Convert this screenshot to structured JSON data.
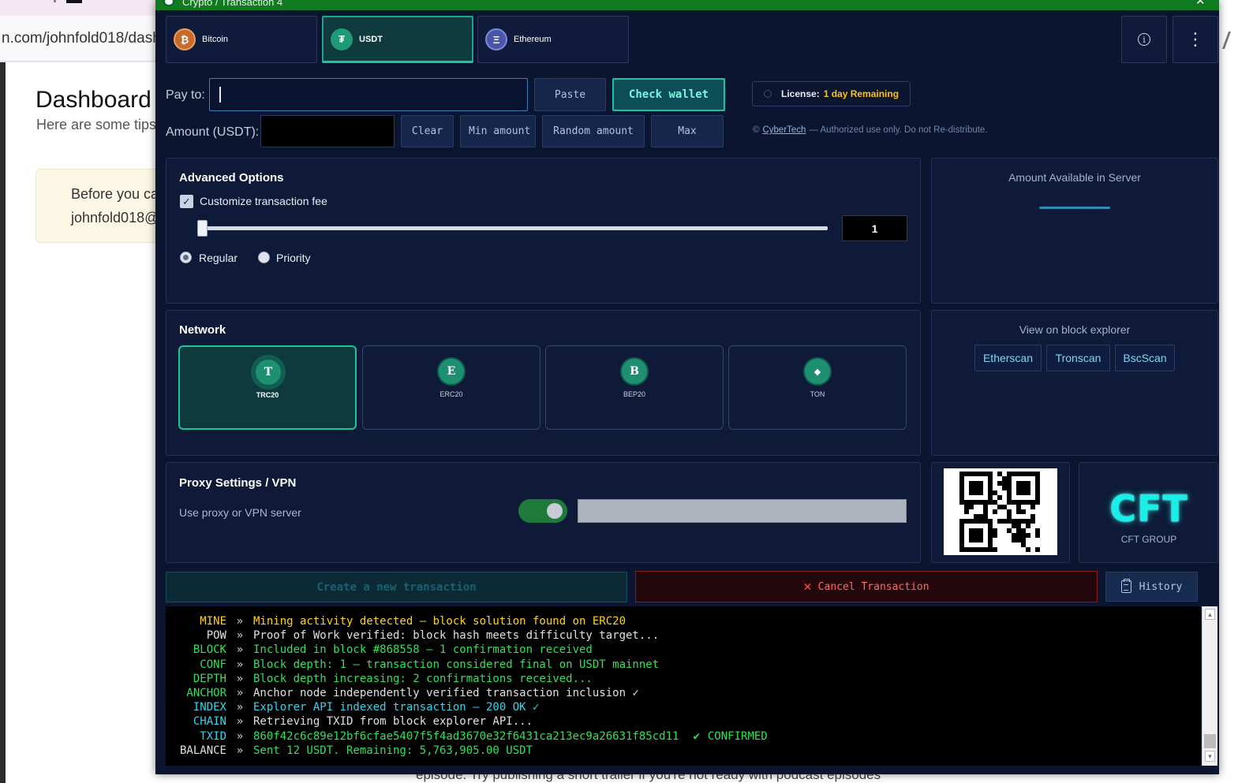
{
  "browser": {
    "url": "n.com/johnfold018/dash",
    "page_title": "Dashboard",
    "page_subtitle": "Here are some tips",
    "notice_line1": "Before you ca",
    "notice_line2": "johnfold018@"
  },
  "window": {
    "title": "Crypto / Transaction 4"
  },
  "coins": [
    {
      "label": "Bitcoin",
      "glyph": "₿",
      "color": "#c76a2a"
    },
    {
      "label": "USDT",
      "glyph": "₮",
      "color": "#1f9a78",
      "active": true
    },
    {
      "label": "Ethereum",
      "glyph": "Ξ",
      "color": "#4a56a8"
    }
  ],
  "toolbar": {
    "info_icon": "info-icon",
    "menu_icon": "kebab-menu-icon",
    "info_glyph": "i",
    "menu_glyph": "⋮"
  },
  "pay": {
    "pay_to_label": "Pay to:",
    "pay_to_value": "",
    "paste_label": "Paste",
    "check_label": "Check wallet",
    "amount_label": "Amount (USDT):",
    "amount_value": "",
    "clear_label": "Clear",
    "min_label": "Min amount",
    "random_label": "Random amount",
    "max_label": "Max"
  },
  "license": {
    "key": "License:",
    "value": "1 day Remaining"
  },
  "copyright": {
    "symbol": "©",
    "brand": "CyberTech",
    "text": "— Authorized use only. Do not Re-distribute."
  },
  "advanced": {
    "heading": "Advanced Options",
    "checkbox_label": "Customize transaction fee",
    "checkbox_checked": true,
    "checkbox_glyph": "✓",
    "fee_value": "1",
    "fee_level": 0,
    "radio_regular": "Regular",
    "radio_priority": "Priority",
    "selected": "Regular"
  },
  "server": {
    "title": "Amount Available in Server"
  },
  "network": {
    "heading": "Network",
    "options": [
      {
        "label": "TRC20",
        "glyph": "T",
        "active": true
      },
      {
        "label": "ERC20",
        "glyph": "E"
      },
      {
        "label": "BEP20",
        "glyph": "B"
      },
      {
        "label": "TON",
        "glyph": "◆"
      }
    ]
  },
  "explorer": {
    "title": "View on block explorer",
    "links": [
      "Etherscan",
      "Tronscan",
      "BscScan"
    ]
  },
  "proxy": {
    "heading": "Proxy Settings / VPN",
    "label": "Use proxy or VPN server",
    "enabled": true,
    "value": ""
  },
  "brand": {
    "logo": "CFT",
    "caption": "CFT GROUP"
  },
  "actions": {
    "create_label": "Create a new transaction",
    "cancel_glyph": "✕",
    "cancel_label": "Cancel Transaction",
    "history_label": "History"
  },
  "console": {
    "separator": "»",
    "confirmed_glyph": "✔",
    "confirmed_text": "CONFIRMED",
    "lines": [
      {
        "tag": "MINE",
        "msg": "Mining activity detected — block solution found on ERC20"
      },
      {
        "tag": "POW",
        "msg": "Proof of Work verified: block hash meets difficulty target..."
      },
      {
        "tag": "BLOCK",
        "msg": "Included in block #868558 — 1 confirmation received"
      },
      {
        "tag": "CONF",
        "msg": "Block depth: 1 — transaction considered final on USDT mainnet"
      },
      {
        "tag": "DEPTH",
        "msg": "Block depth increasing: 2 confirmations received..."
      },
      {
        "tag": "ANCHOR",
        "msg": "Anchor node independently verified transaction inclusion ✓"
      },
      {
        "tag": "INDEX",
        "msg": "Explorer API indexed transaction — 200 OK ✓"
      },
      {
        "tag": "CHAIN",
        "msg": "Retrieving TXID from block explorer API..."
      },
      {
        "tag": "TXID",
        "msg": "860f42c6c89e12bf6cfae5407f5f4ad3670e32f6431ca213ec9a26631f85cd11"
      },
      {
        "tag": "BALANCE",
        "msg": "Sent 12 USDT.  Remaining: 5,763,905.00 USDT"
      }
    ]
  },
  "scroll": {
    "up_glyph": "▲",
    "down_glyph": "▼"
  },
  "background_page": {
    "bottom_text": "episode. Try publishing a short trailer if you're not ready with podcast episodes"
  }
}
